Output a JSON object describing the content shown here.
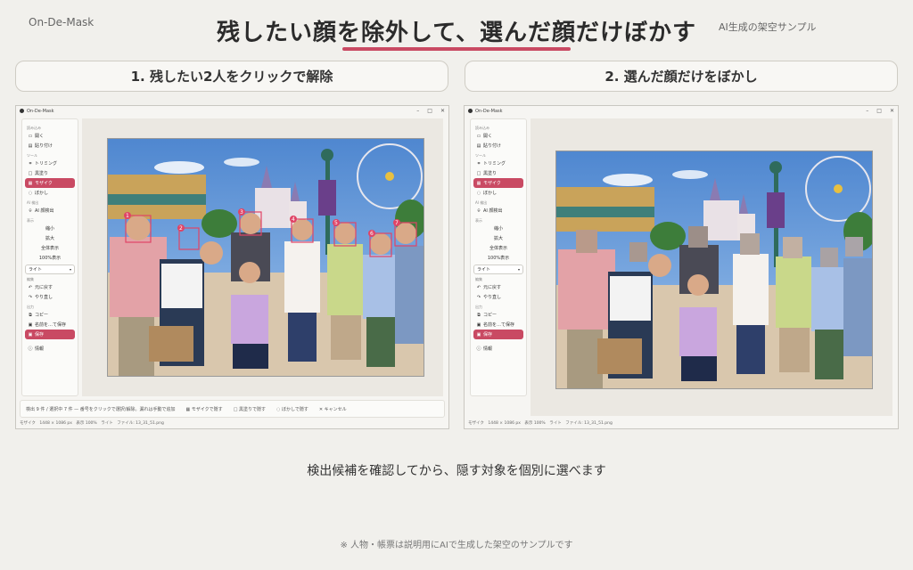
{
  "brand": "On-De-Mask",
  "title": "残したい顔を除外して、選んだ顔だけぼかす",
  "ai_sample_label": "AI生成の架空サンプル",
  "step1_label": "1. 残したい2人をクリックで解除",
  "step2_label": "2. 選んだ顔だけをぼかし",
  "window": {
    "title": "On-De-Mask",
    "controls": [
      "–",
      "□",
      "✕"
    ]
  },
  "sidebar": {
    "sec_file": "読み込み",
    "open": "開く",
    "paste": "貼り付け",
    "sec_tool": "ツール",
    "trim": "トリミング",
    "blackout": "黒塗り",
    "mosaic": "モザイク",
    "blur": "ぼかし",
    "sec_ai": "AI 検出",
    "ai_detect": "AI 顔検出",
    "sec_view": "表示",
    "zoom_out": "縮小",
    "zoom_in": "拡大",
    "fit": "全体表示",
    "actual": "100%表示",
    "theme": "ライト",
    "sec_edit": "編集",
    "undo": "元に戻す",
    "redo": "やり直し",
    "sec_save": "出力",
    "copy": "コピー",
    "save_as": "名前を…て保存",
    "save": "保存",
    "info": "情報"
  },
  "sidebar_icons": {
    "open": "folder-icon",
    "paste": "clipboard-icon",
    "trim": "crop-icon",
    "blackout": "square-icon",
    "mosaic": "grid-icon",
    "blur": "drop-icon",
    "ai_detect": "face-scan-icon",
    "undo": "undo-icon",
    "redo": "redo-icon",
    "copy": "copy-icon",
    "save_as": "save-as-icon",
    "save": "save-icon",
    "info": "info-icon"
  },
  "bottombar": {
    "status": "検出 9 件 / 選択中 7 件 — 番号をクリックで選択/解除。漏れは手動で追加",
    "mosaic_btn": "モザイクで隠す",
    "blackout_btn": "黒塗りで隠す",
    "blur_btn": "ぼかしで隠す",
    "cancel_btn": "キャンセル"
  },
  "statusbar": "モザイク　1448 × 1086 px　表示 100%　ライト　ファイル: 13_31_51.png",
  "caption": "検出候補を確認してから、隠す対象を個別に選べます",
  "footnote": "※ 人物・帳票は説明用にAIで生成した架空のサンプルです",
  "colors": {
    "accent": "#c94a63",
    "background": "#f1f0ec",
    "sky": "#5b93d6"
  },
  "face_markers": [
    "1",
    "2",
    "3",
    "4",
    "5",
    "6",
    "7",
    "8",
    "9"
  ]
}
